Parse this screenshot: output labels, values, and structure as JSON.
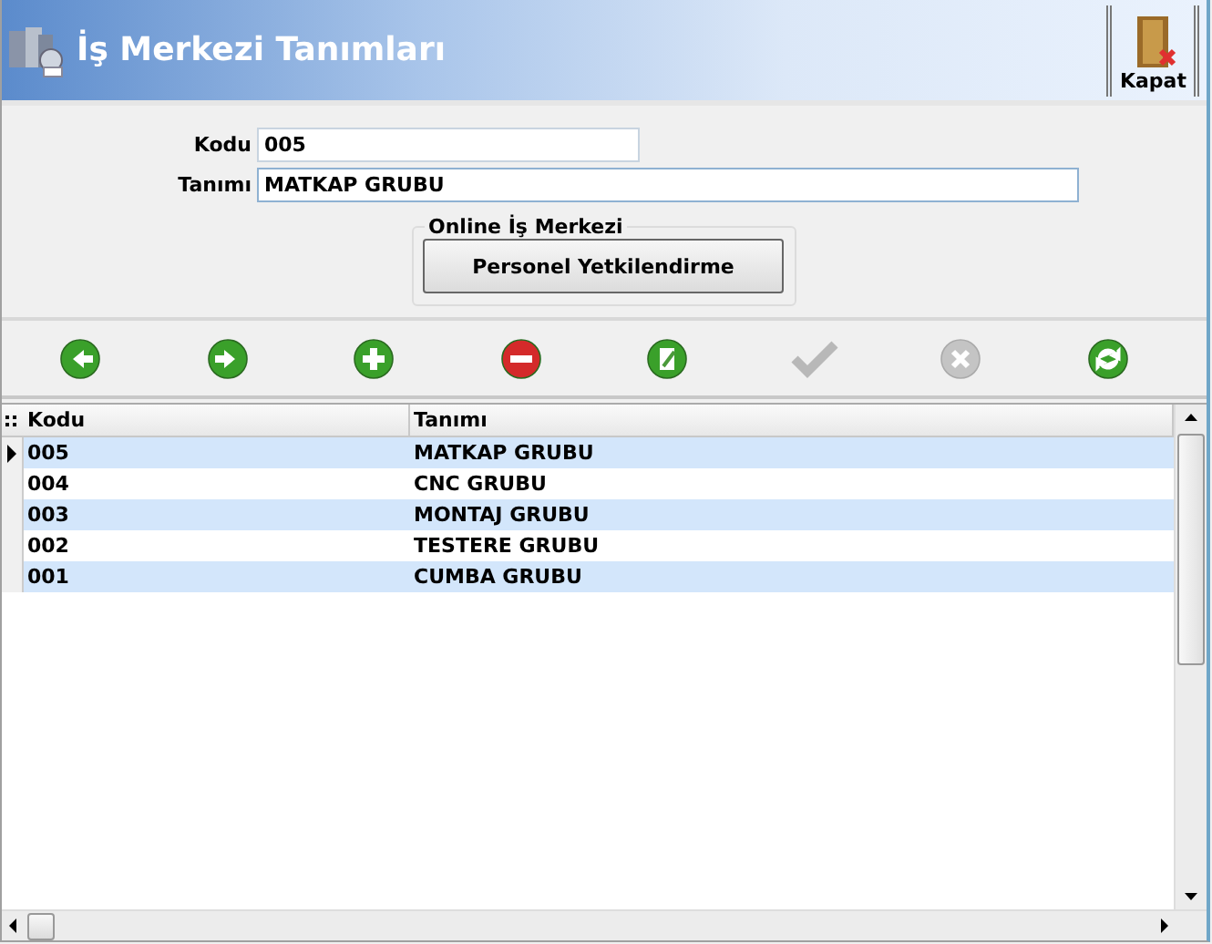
{
  "window": {
    "title": "İş Merkezi Tanımları",
    "close_label": "Kapat"
  },
  "form": {
    "fields": [
      {
        "label": "Kodu",
        "value": "005",
        "kind": "short"
      },
      {
        "label": "Tanımı",
        "value": "MATKAP GRUBU",
        "kind": "long"
      }
    ],
    "group": {
      "title": "Online İş Merkezi",
      "button": "Personel Yetkilendirme"
    }
  },
  "toolbar": [
    {
      "kind": "prev",
      "disabled": false
    },
    {
      "kind": "next",
      "disabled": false
    },
    {
      "kind": "add",
      "disabled": false
    },
    {
      "kind": "delete",
      "disabled": false
    },
    {
      "kind": "edit",
      "disabled": false
    },
    {
      "kind": "save",
      "disabled": true
    },
    {
      "kind": "cancel",
      "disabled": true
    },
    {
      "kind": "refresh",
      "disabled": false
    }
  ],
  "table": {
    "columns": [
      "Kodu",
      "Tanımı"
    ],
    "rows": [
      {
        "cells": [
          "005",
          "MATKAP GRUBU"
        ],
        "selected": true
      },
      {
        "cells": [
          "004",
          "CNC GRUBU"
        ],
        "selected": false
      },
      {
        "cells": [
          "003",
          "MONTAJ GRUBU"
        ],
        "selected": false
      },
      {
        "cells": [
          "002",
          "TESTERE GRUBU"
        ],
        "selected": false
      },
      {
        "cells": [
          "001",
          "CUMBA GRUBU"
        ],
        "selected": false
      }
    ]
  }
}
